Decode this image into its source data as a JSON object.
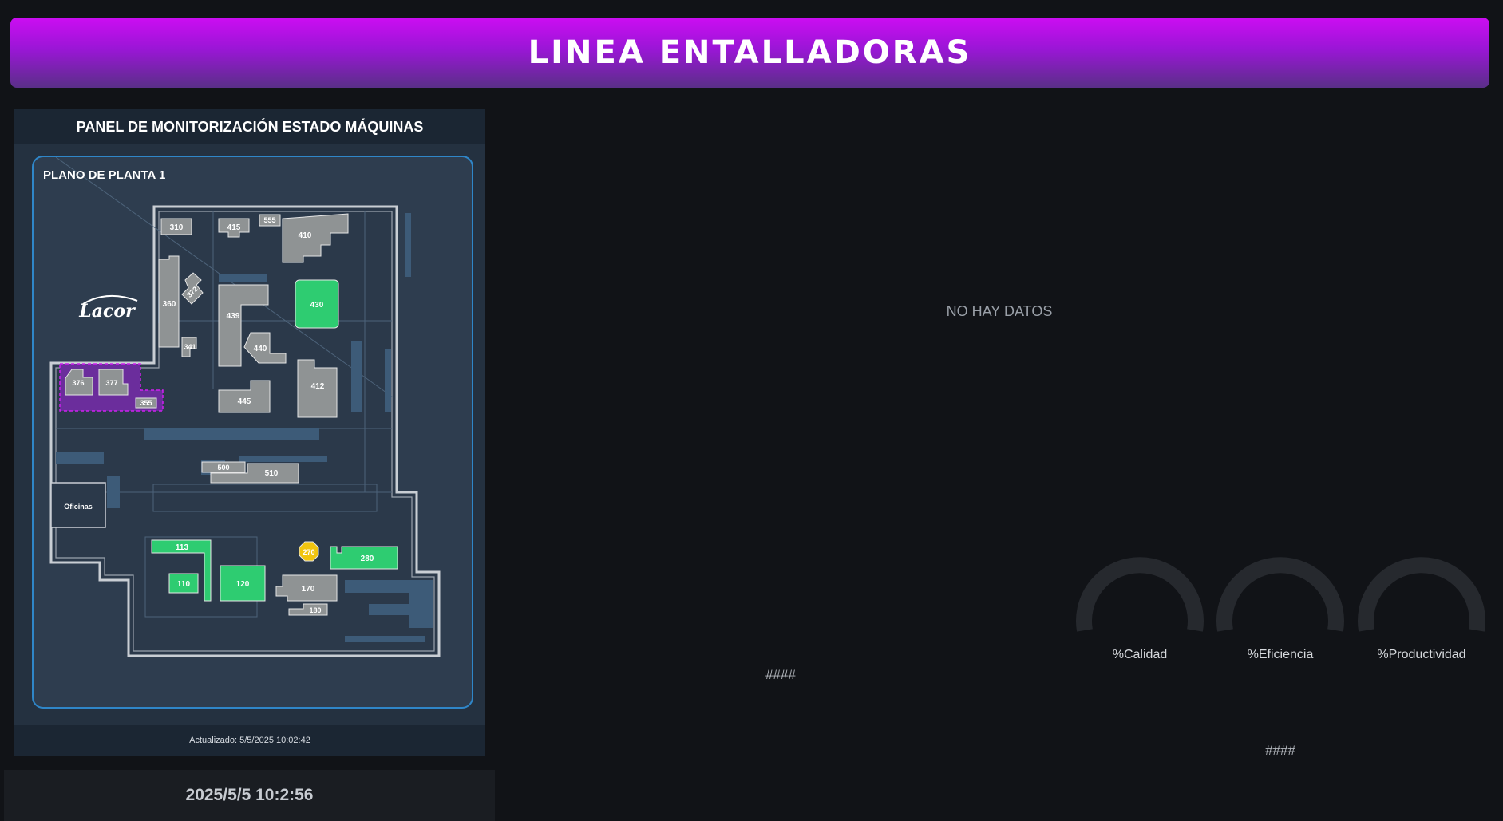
{
  "header": {
    "title": "LINEA ENTALLADORAS"
  },
  "panel": {
    "title": "PANEL DE MONITORIZACIÓN ESTADO MÁQUINAS",
    "plan_title": "PLANO DE PLANTA 1",
    "logo_text": "Lacor",
    "offices_label": "Oficinas",
    "updated": "Actualizado: 5/5/2025 10:02:42",
    "machines": {
      "m310": "310",
      "m415": "415",
      "m555": "555",
      "m410": "410",
      "m360": "360",
      "m372": "372",
      "m341": "341",
      "m439": "439",
      "m440": "440",
      "m430": "430",
      "m412": "412",
      "m445": "445",
      "m376": "376",
      "m377": "377",
      "m355": "355",
      "m500": "500",
      "m510": "510",
      "m113": "113",
      "m110": "110",
      "m120": "120",
      "m270": "270",
      "m280": "280",
      "m170": "170",
      "m180": "180"
    },
    "status_colors": {
      "idle": "#8f9394",
      "running": "#2ecc71",
      "warning": "#f1c40f",
      "selected": "#7b2aa6"
    }
  },
  "clock": {
    "datetime": "2025/5/5 10:2:56"
  },
  "main": {
    "no_data": "NO HAY DATOS",
    "value_a": "####",
    "value_b": "####",
    "gauges": {
      "quality": "%Calidad",
      "efficiency": "%Eficiencia",
      "productivity": "%Productividad"
    }
  }
}
